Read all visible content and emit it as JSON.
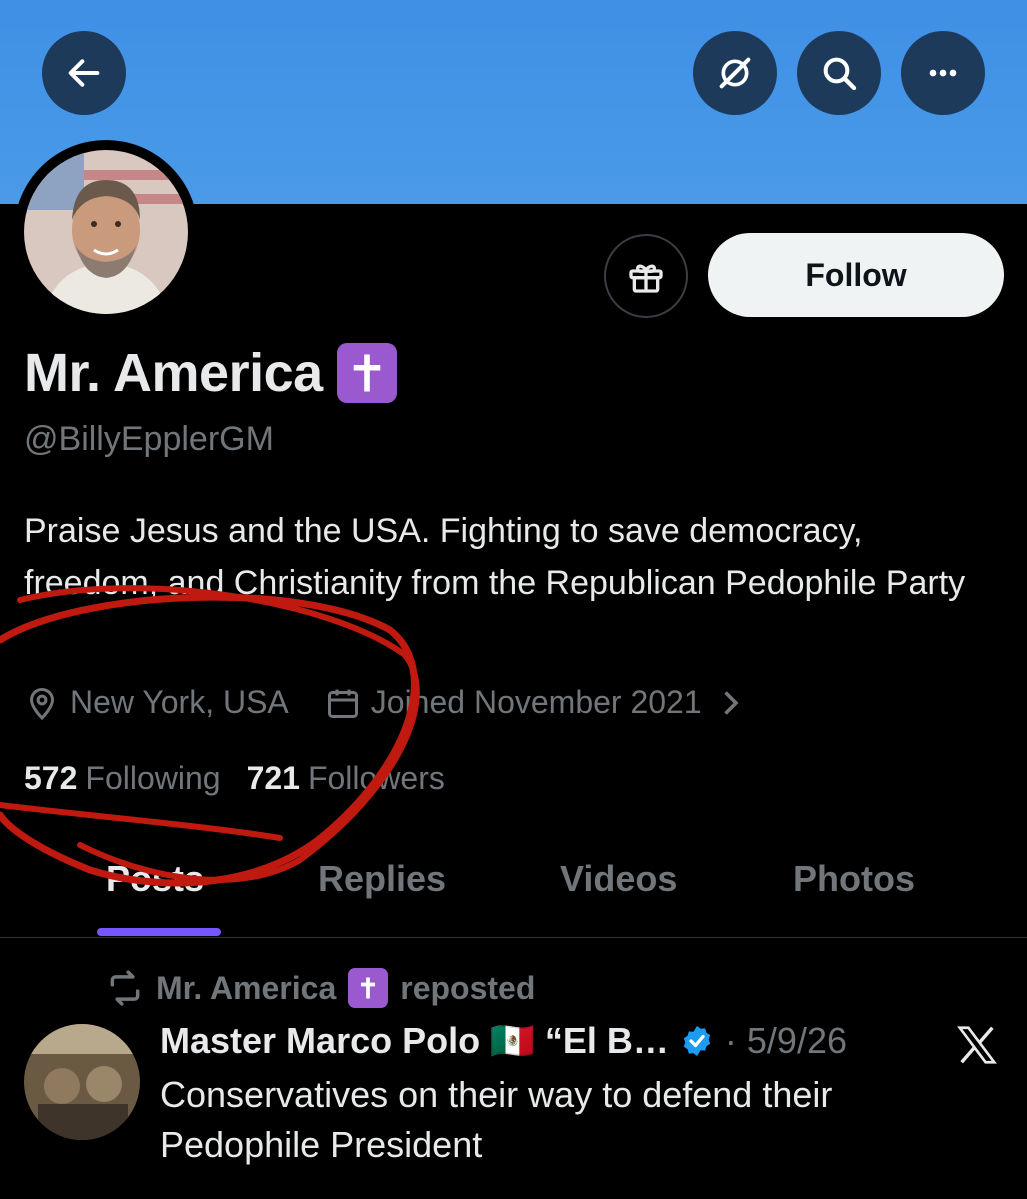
{
  "header": {
    "back_icon": "arrow-left-icon",
    "grok_icon": "grok-icon",
    "search_icon": "search-icon",
    "more_icon": "more-icon",
    "banner_color": "#4a9ae8"
  },
  "profile": {
    "name": "Mr. America",
    "name_badge": "✝️",
    "handle": "@BillyEpplerGM",
    "follow_label": "Follow",
    "bio": "Praise Jesus and the USA. Fighting to save democracy, freedom, and Christianity from the Republican Pedophile Party",
    "location": "New York, USA",
    "joined": "Joined November 2021",
    "following_count": "572",
    "following_label": "Following",
    "followers_count": "721",
    "followers_label": "Followers"
  },
  "tabs": [
    {
      "label": "Posts",
      "active": true
    },
    {
      "label": "Replies",
      "active": false
    },
    {
      "label": "Videos",
      "active": false
    },
    {
      "label": "Photos",
      "active": false
    }
  ],
  "post": {
    "repost_by": "Mr. America",
    "repost_label": "reposted",
    "author": "Master Marco Polo 🇲🇽 “El B…",
    "date": "· 5/9/26",
    "text": "Conservatives on their way to defend  their Pedophile President"
  },
  "colors": {
    "accent": "#7856ff",
    "badge": "#9b59d0",
    "verified": "#1d9bf0",
    "annotation": "#c01a10"
  }
}
